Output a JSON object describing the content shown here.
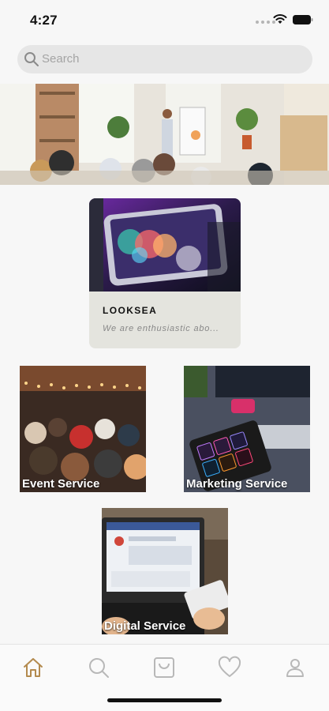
{
  "status_bar": {
    "time": "4:27"
  },
  "search": {
    "placeholder": "Search"
  },
  "featured": {
    "title": "LOOKSEA",
    "description": "We are enthusiastic abo..."
  },
  "services": [
    {
      "label": "Event Service"
    },
    {
      "label": "Marketing Service"
    },
    {
      "label": "Digital Service"
    }
  ],
  "nav": {
    "items": [
      "home-icon",
      "search-icon",
      "cart-icon",
      "heart-icon",
      "profile-icon"
    ],
    "active_color": "#b38a4e",
    "inactive_color": "#b8b8b8"
  }
}
